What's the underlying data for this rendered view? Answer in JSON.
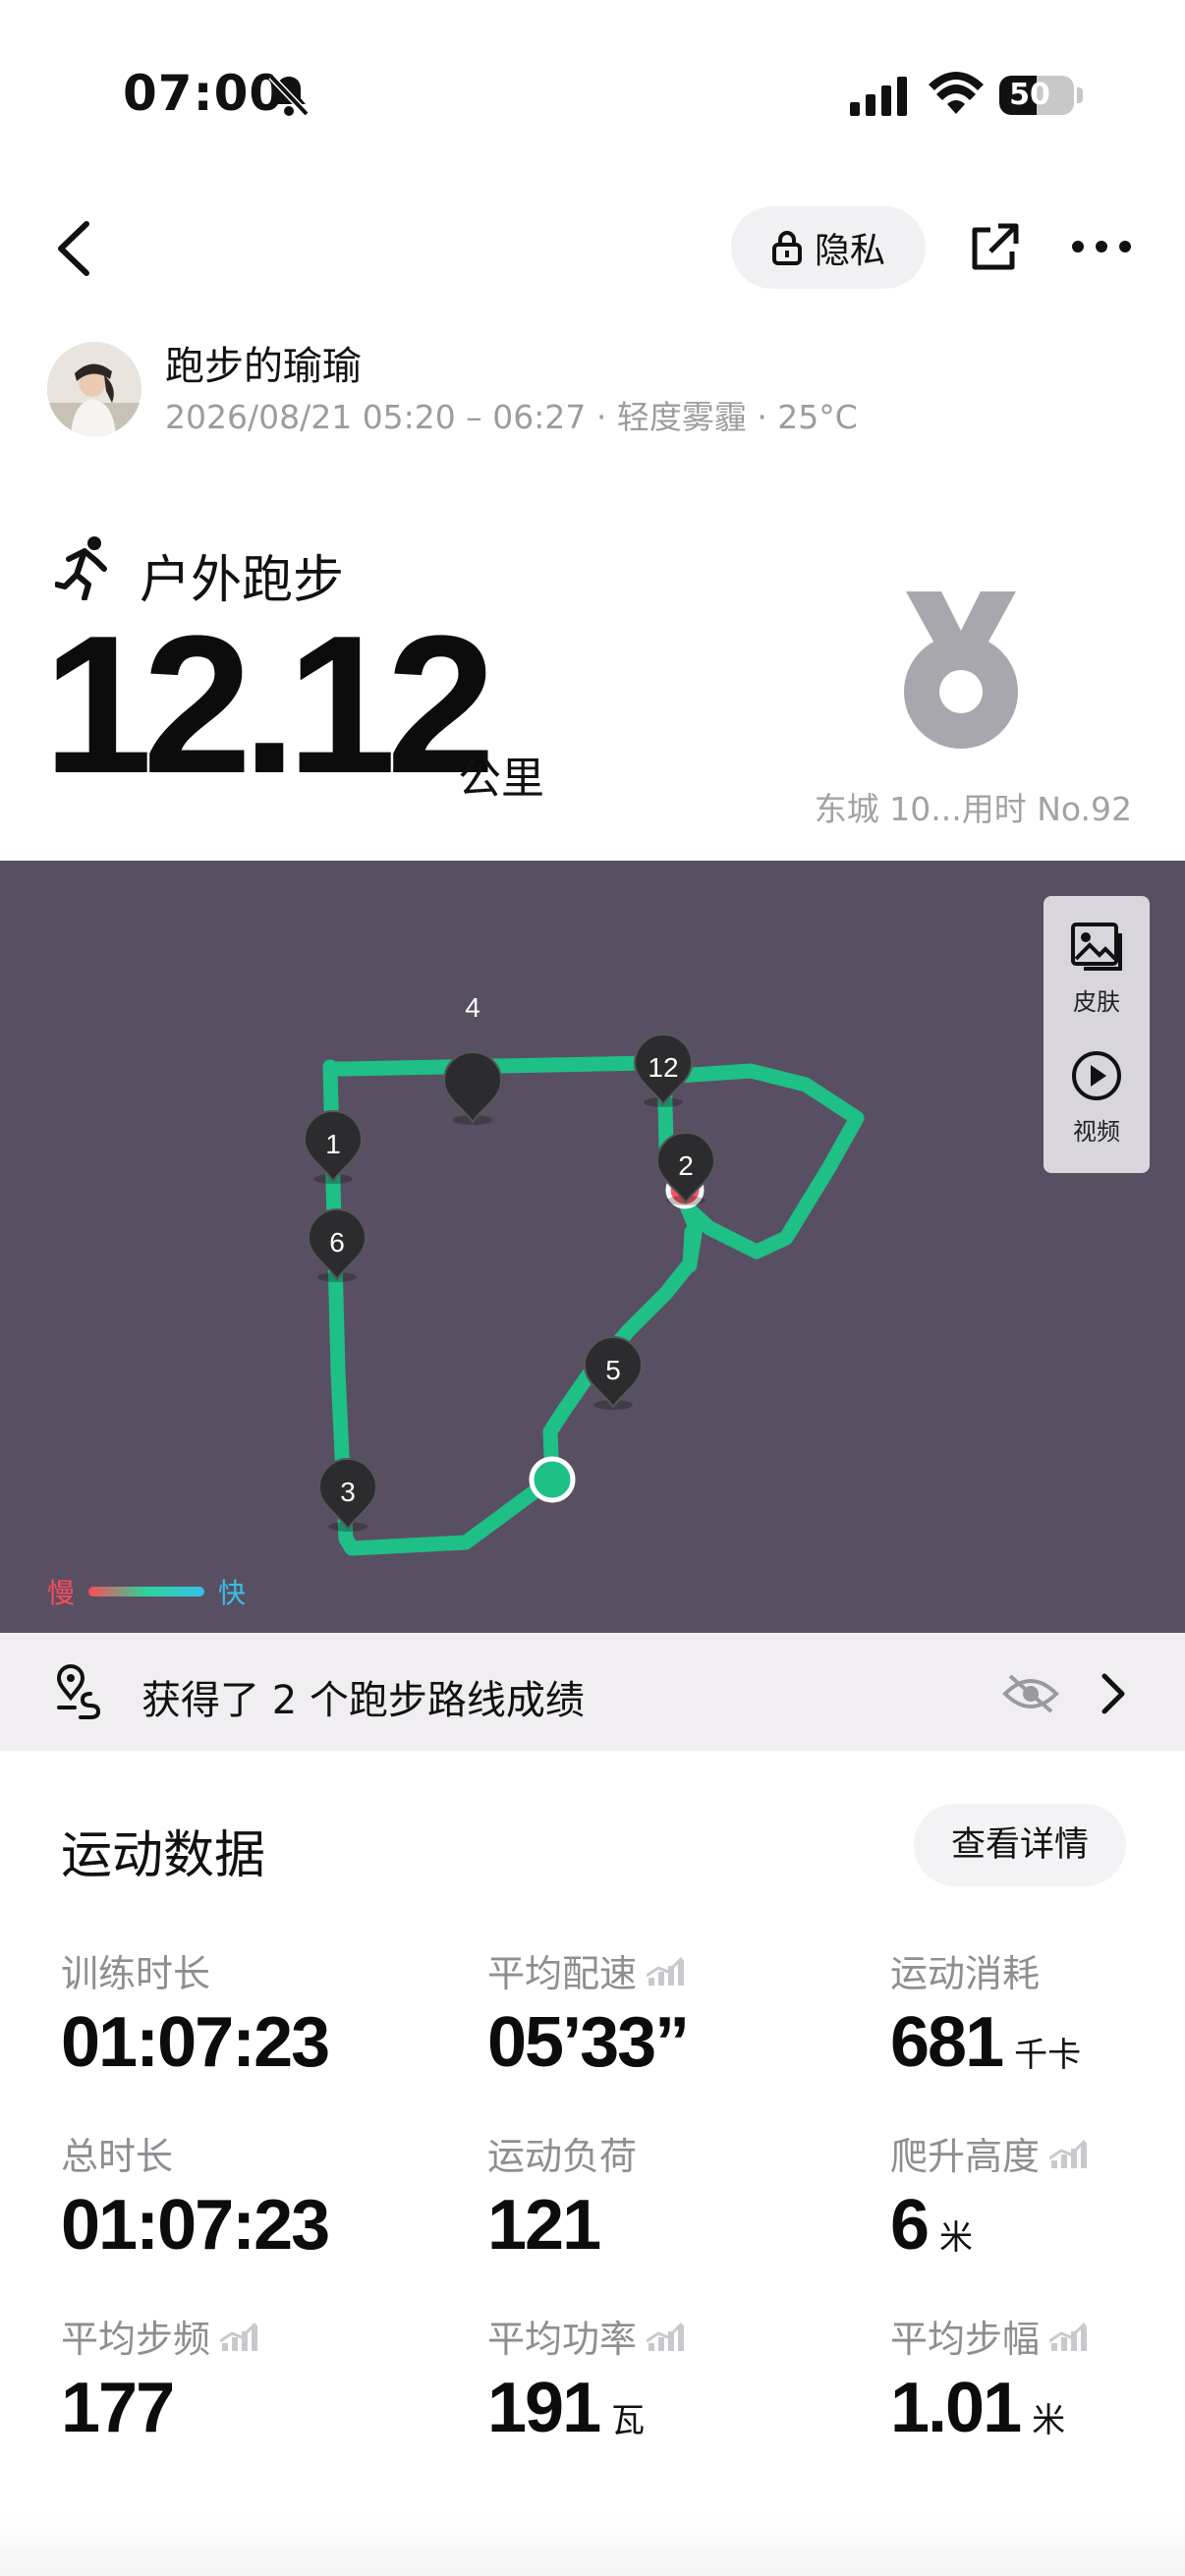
{
  "status_bar": {
    "time": "07:00",
    "battery": "50",
    "battery_level": 0.5
  },
  "header": {
    "privacy_label": "隐私"
  },
  "user": {
    "name": "跑步的瑜瑜",
    "meta": "2026/08/21 05:20 – 06:27 · 轻度雾霾 · 25°C"
  },
  "activity": {
    "type": "户外跑步",
    "distance": "12.12",
    "distance_unit": "公里",
    "medal_caption": "东城 10...用时 No.92"
  },
  "map": {
    "tools": [
      {
        "label": "皮肤",
        "icon": "image-icon"
      },
      {
        "label": "视频",
        "icon": "play-icon"
      }
    ],
    "legend": {
      "slow": "慢",
      "fast": "快"
    },
    "km_markers": [
      "4",
      "12",
      "1",
      "2",
      "6",
      "5",
      "3"
    ],
    "route_color": "#1fbf88"
  },
  "route_achievement": {
    "text": "获得了 2 个跑步路线成绩"
  },
  "stats": {
    "title": "运动数据",
    "details_label": "查看详情",
    "items": [
      {
        "label": "训练时长",
        "value": "01:07:23",
        "unit": ""
      },
      {
        "label": "平均配速",
        "value": "05’33”",
        "unit": ""
      },
      {
        "label": "运动消耗",
        "value": "681",
        "unit": "千卡"
      },
      {
        "label": "总时长",
        "value": "01:07:23",
        "unit": ""
      },
      {
        "label": "运动负荷",
        "value": "121",
        "unit": ""
      },
      {
        "label": "爬升高度",
        "value": "6",
        "unit": "米"
      },
      {
        "label": "平均步频",
        "value": "177",
        "unit": ""
      },
      {
        "label": "平均功率",
        "value": "191",
        "unit": "瓦"
      },
      {
        "label": "平均步幅",
        "value": "1.01",
        "unit": "米"
      }
    ]
  }
}
